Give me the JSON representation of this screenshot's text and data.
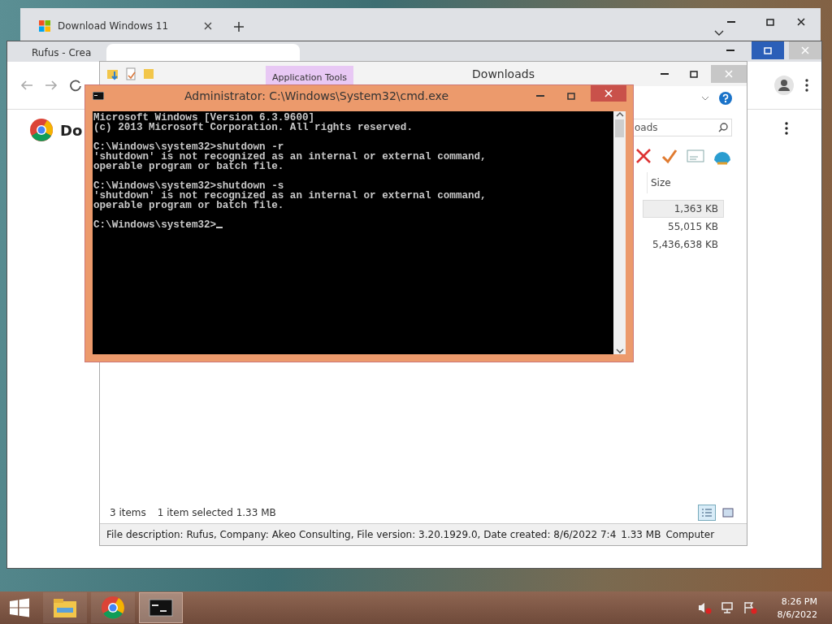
{
  "browser_back": {
    "tab": {
      "title": "Download Windows 11"
    }
  },
  "browser_front": {
    "tabs": [
      {
        "title": "Rufus - Crea",
        "selected": false
      },
      {
        "selected": true
      }
    ],
    "page_heading": "Do"
  },
  "explorer": {
    "title": "Downloads",
    "ribbon_tab": "Application Tools",
    "search_value": "oads",
    "columns": [
      "Size"
    ],
    "rows": [
      {
        "size": "1,363 KB",
        "selected": true
      },
      {
        "size": "55,015 KB",
        "selected": false
      },
      {
        "size": "5,436,638 KB",
        "selected": false
      }
    ],
    "status": {
      "items": "3 items",
      "selection": "1 item selected  1.33 MB"
    },
    "details": {
      "description": "File description: Rufus, Company: Akeo Consulting, File version: 3.20.1929.0, Date created: 8/6/2022 7:4",
      "size": "1.33 MB",
      "location": "Computer"
    }
  },
  "console": {
    "title": "Administrator: C:\\Windows\\System32\\cmd.exe",
    "blocks": [
      [
        "Microsoft Windows [Version 6.3.9600]",
        "(c) 2013 Microsoft Corporation. All rights reserved."
      ],
      [
        "C:\\Windows\\system32>shutdown -r",
        "'shutdown' is not recognized as an internal or external command,",
        "operable program or batch file."
      ],
      [
        "C:\\Windows\\system32>shutdown -s",
        "'shutdown' is not recognized as an internal or external command,",
        "operable program or batch file."
      ],
      [
        "C:\\Windows\\system32>"
      ]
    ]
  },
  "taskbar": {
    "apps": [
      {
        "kind": "explorer",
        "selected": false
      },
      {
        "kind": "chrome",
        "selected": false
      },
      {
        "kind": "cmd",
        "selected": true
      }
    ],
    "time": "8:26 PM",
    "date": "8/6/2022"
  }
}
